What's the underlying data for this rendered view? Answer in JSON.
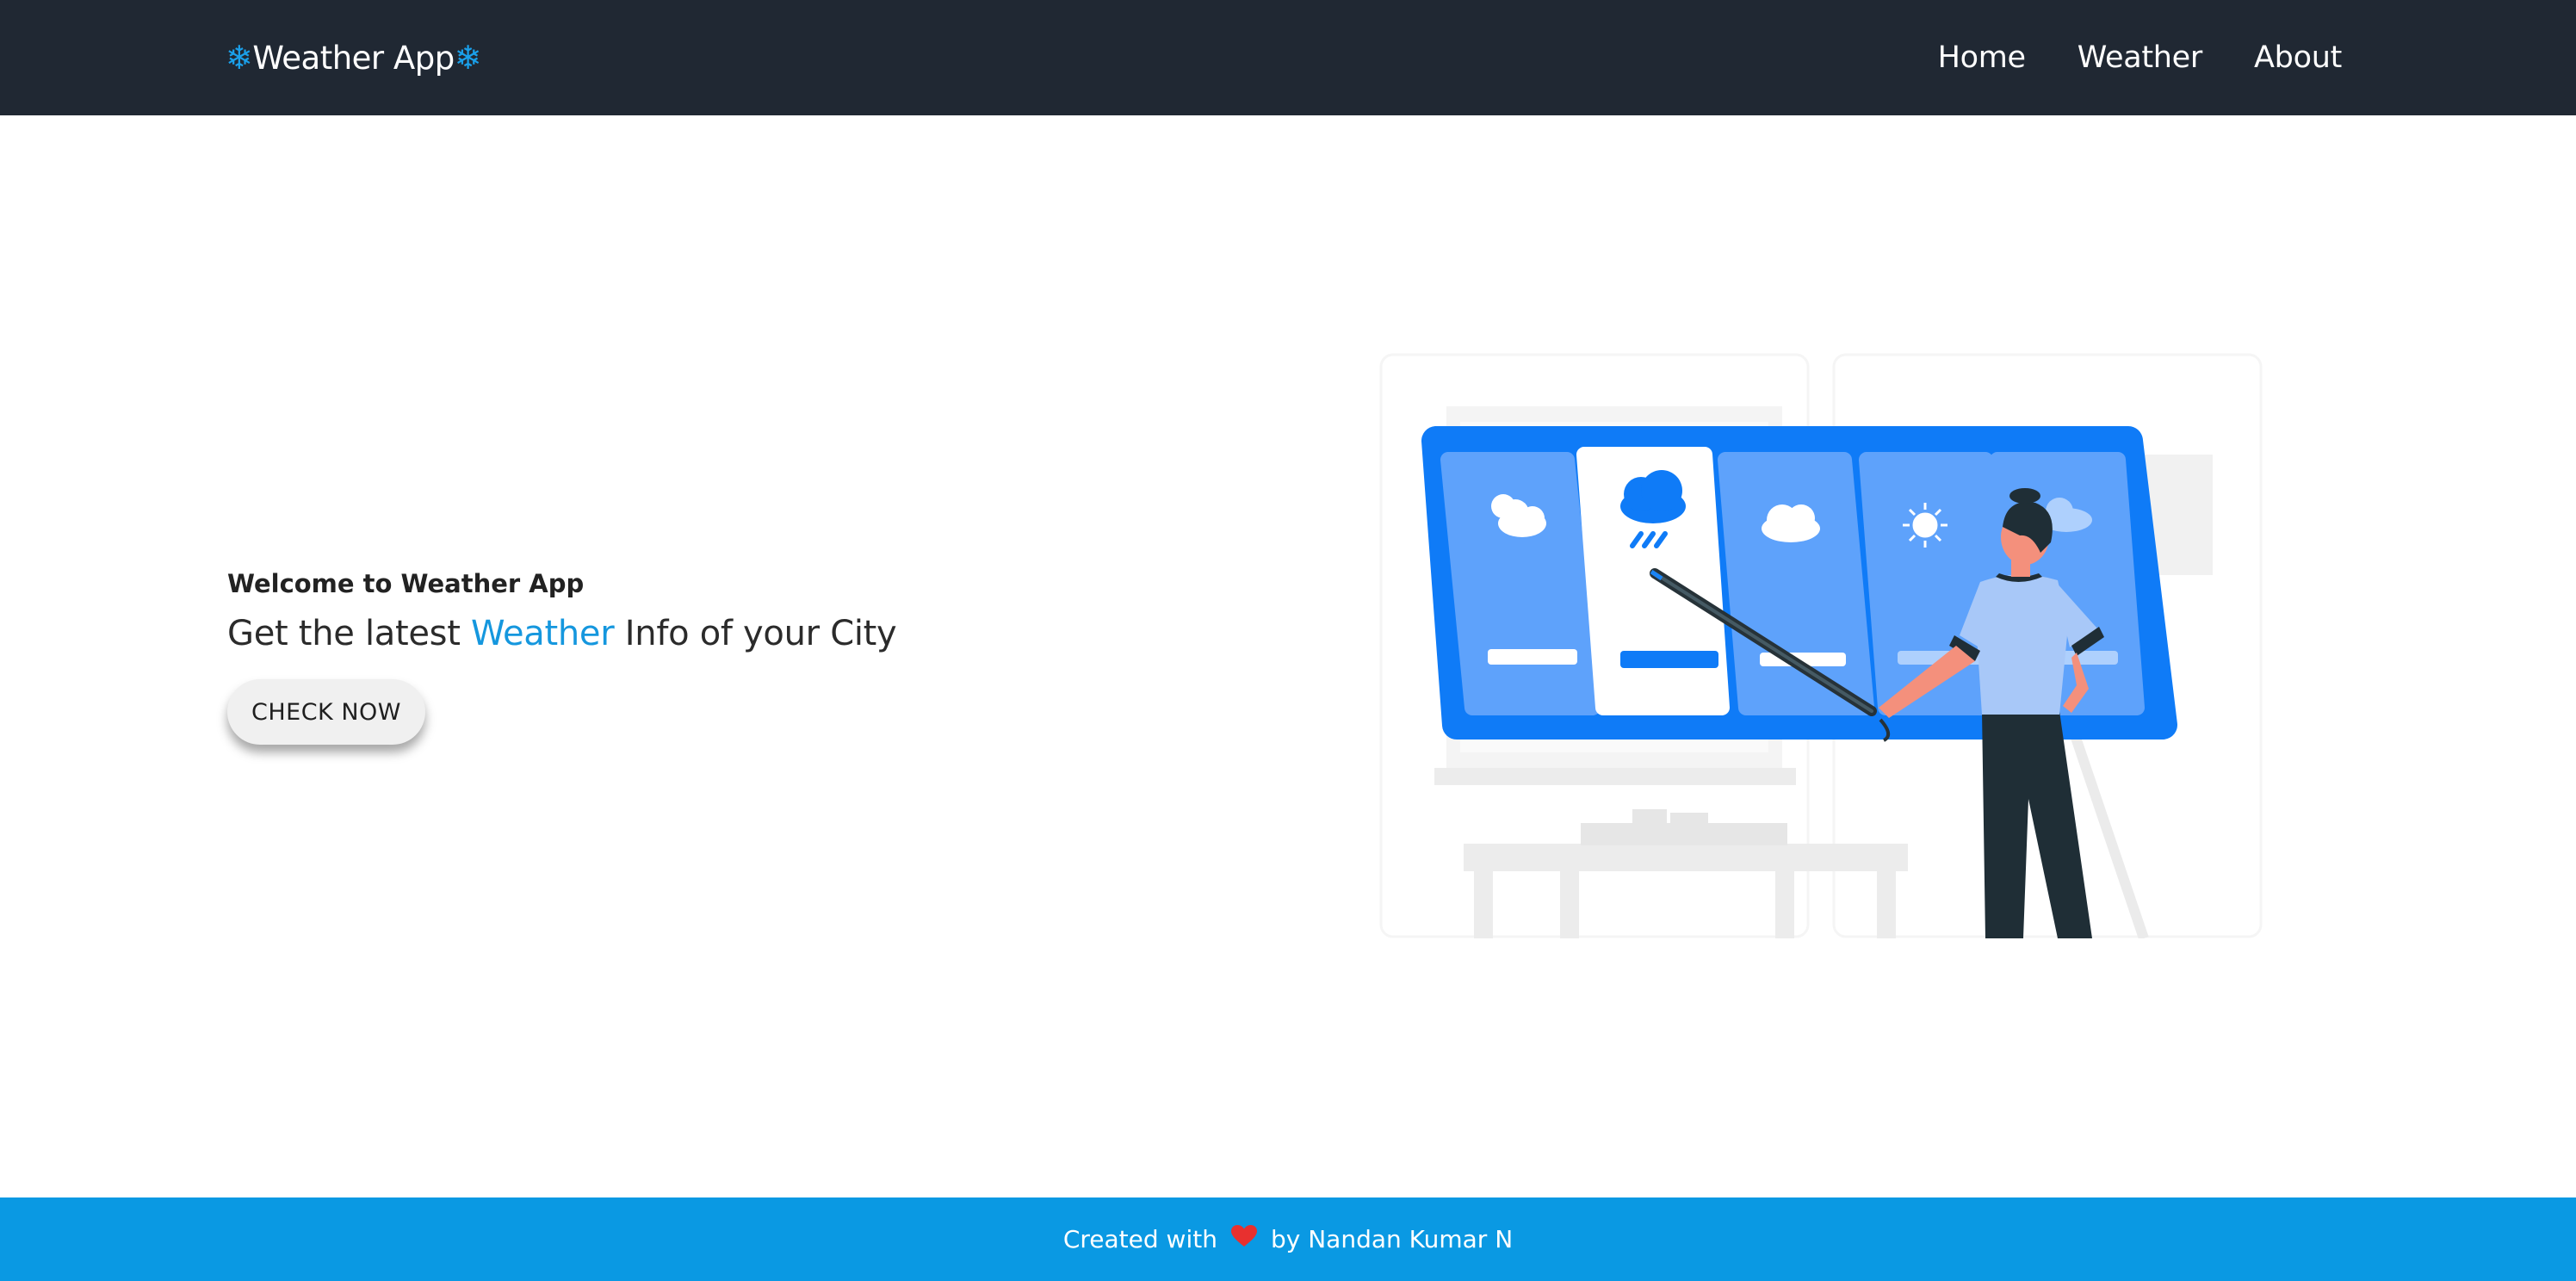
{
  "navbar": {
    "brand": "Weather App",
    "brand_icon": "snowflake-icon",
    "links": [
      "Home",
      "Weather",
      "About"
    ]
  },
  "hero": {
    "welcome": "Welcome to Weather App",
    "headline_prefix": "Get the latest ",
    "headline_accent": "Weather",
    "headline_suffix": " Info of your City",
    "button_label": "CHECK NOW"
  },
  "illustration": {
    "subject": "weather-board-illustration"
  },
  "footer": {
    "prefix": "Created with",
    "icon": "heart-icon",
    "suffix": "by Nandan Kumar N"
  },
  "colors": {
    "navbar_bg": "#202833",
    "accent": "#1597de",
    "footer_bg": "#0a99e3",
    "board_blue": "#0f7bf7",
    "heart": "#e8302f"
  }
}
